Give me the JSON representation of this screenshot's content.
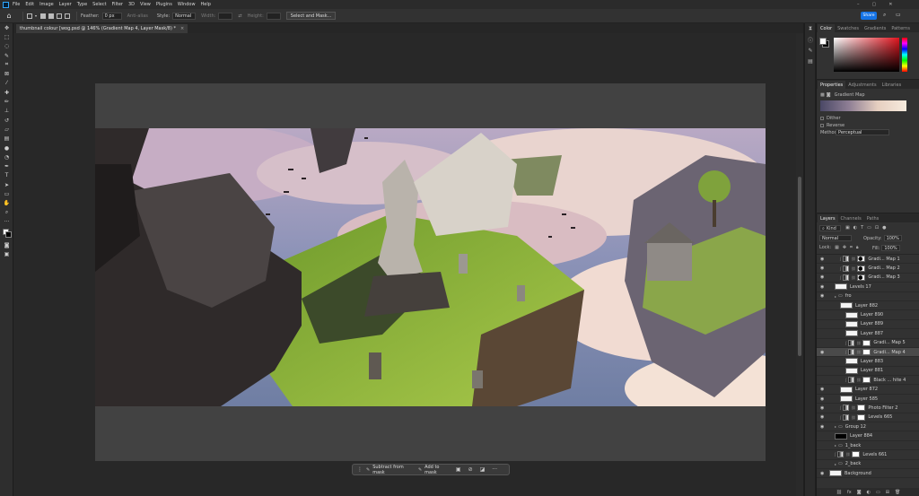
{
  "menubar": {
    "items": [
      "File",
      "Edit",
      "Image",
      "Layer",
      "Type",
      "Select",
      "Filter",
      "3D",
      "View",
      "Plugins",
      "Window",
      "Help"
    ]
  },
  "options": {
    "feather_label": "Feather:",
    "feather_value": "0 px",
    "antialias_label": "Anti-alias",
    "style_label": "Style:",
    "style_value": "Normal",
    "width_label": "Width:",
    "height_label": "Height:",
    "select_mask_label": "Select and Mask...",
    "share_label": "Share"
  },
  "document": {
    "tab_title": "thumbnail colour [wog.psd @ 146% (Gradient Map 4, Layer Mask/8) *",
    "tab_close": "×"
  },
  "context_bar": {
    "subtract_label": "Subtract from mask",
    "add_label": "Add to mask",
    "more": "···"
  },
  "color_panel": {
    "tabs": [
      "Color",
      "Swatches",
      "Gradients",
      "Patterns"
    ],
    "fg_color": "#ffffff",
    "bg_color": "#000000",
    "hue_color": "#e0151f"
  },
  "properties_panel": {
    "tabs": [
      "Properties",
      "Adjustments",
      "Libraries"
    ],
    "type_label": "Gradient Map",
    "dither_label": "Dither",
    "reverse_label": "Reverse",
    "method_label": "Method:",
    "method_value": "Perceptual"
  },
  "layers_panel": {
    "tabs": [
      "Layers",
      "Channels",
      "Paths"
    ],
    "kind_label": "Kind",
    "blend_mode": "Normal",
    "opacity_label": "Opacity:",
    "opacity_value": "100%",
    "lock_label": "Lock:",
    "fill_label": "Fill:",
    "fill_value": "100%",
    "layers": [
      {
        "name": "Gradi... Map 1",
        "thumb": "adj",
        "mask": "blob",
        "visible": true,
        "indent": 2
      },
      {
        "name": "Gradi... Map 2",
        "thumb": "adj",
        "mask": "blob",
        "visible": true,
        "indent": 2
      },
      {
        "name": "Gradi... Map 3",
        "thumb": "adj",
        "mask": "blob",
        "visible": true,
        "indent": 2
      },
      {
        "name": "Levels 17",
        "thumb": "normal",
        "visible": true,
        "indent": 1
      },
      {
        "name": "fro",
        "thumb": "folder",
        "visible": true,
        "indent": 1
      },
      {
        "name": "Layer 882",
        "thumb": "normal",
        "visible": false,
        "indent": 2
      },
      {
        "name": "Layer 890",
        "thumb": "normal",
        "visible": false,
        "indent": 3
      },
      {
        "name": "Layer 889",
        "thumb": "normal",
        "visible": false,
        "indent": 3
      },
      {
        "name": "Layer 887",
        "thumb": "normal",
        "visible": false,
        "indent": 3
      },
      {
        "name": "Gradi... Map 5",
        "thumb": "adj",
        "mask": "white",
        "visible": false,
        "indent": 3
      },
      {
        "name": "Gradi... Map 4",
        "thumb": "adj",
        "mask": "white",
        "visible": true,
        "indent": 3,
        "selected": true
      },
      {
        "name": "Layer 883",
        "thumb": "normal",
        "visible": false,
        "indent": 3
      },
      {
        "name": "Layer 881",
        "thumb": "normal",
        "visible": false,
        "indent": 3
      },
      {
        "name": "Black ... hite 4",
        "thumb": "adj",
        "mask": "white",
        "visible": false,
        "indent": 3
      },
      {
        "name": "Layer 872",
        "thumb": "normal",
        "visible": true,
        "indent": 2
      },
      {
        "name": "Layer 585",
        "thumb": "normal",
        "visible": true,
        "indent": 2
      },
      {
        "name": "Photo Filter 2",
        "thumb": "adj",
        "mask": "white",
        "visible": true,
        "indent": 2
      },
      {
        "name": "Levels 665",
        "thumb": "adj",
        "mask": "white",
        "visible": true,
        "indent": 2
      },
      {
        "name": "Group 12",
        "thumb": "folder",
        "visible": true,
        "indent": 1
      },
      {
        "name": "Layer 884",
        "thumb": "dark",
        "visible": false,
        "indent": 1
      },
      {
        "name": "1_back",
        "thumb": "folder",
        "visible": false,
        "indent": 1
      },
      {
        "name": "Levels 661",
        "thumb": "adj",
        "mask": "white",
        "visible": false,
        "indent": 1
      },
      {
        "name": "2_back",
        "thumb": "folder",
        "visible": false,
        "indent": 1
      },
      {
        "name": "Background",
        "thumb": "normal",
        "visible": true,
        "indent": 0
      }
    ]
  }
}
